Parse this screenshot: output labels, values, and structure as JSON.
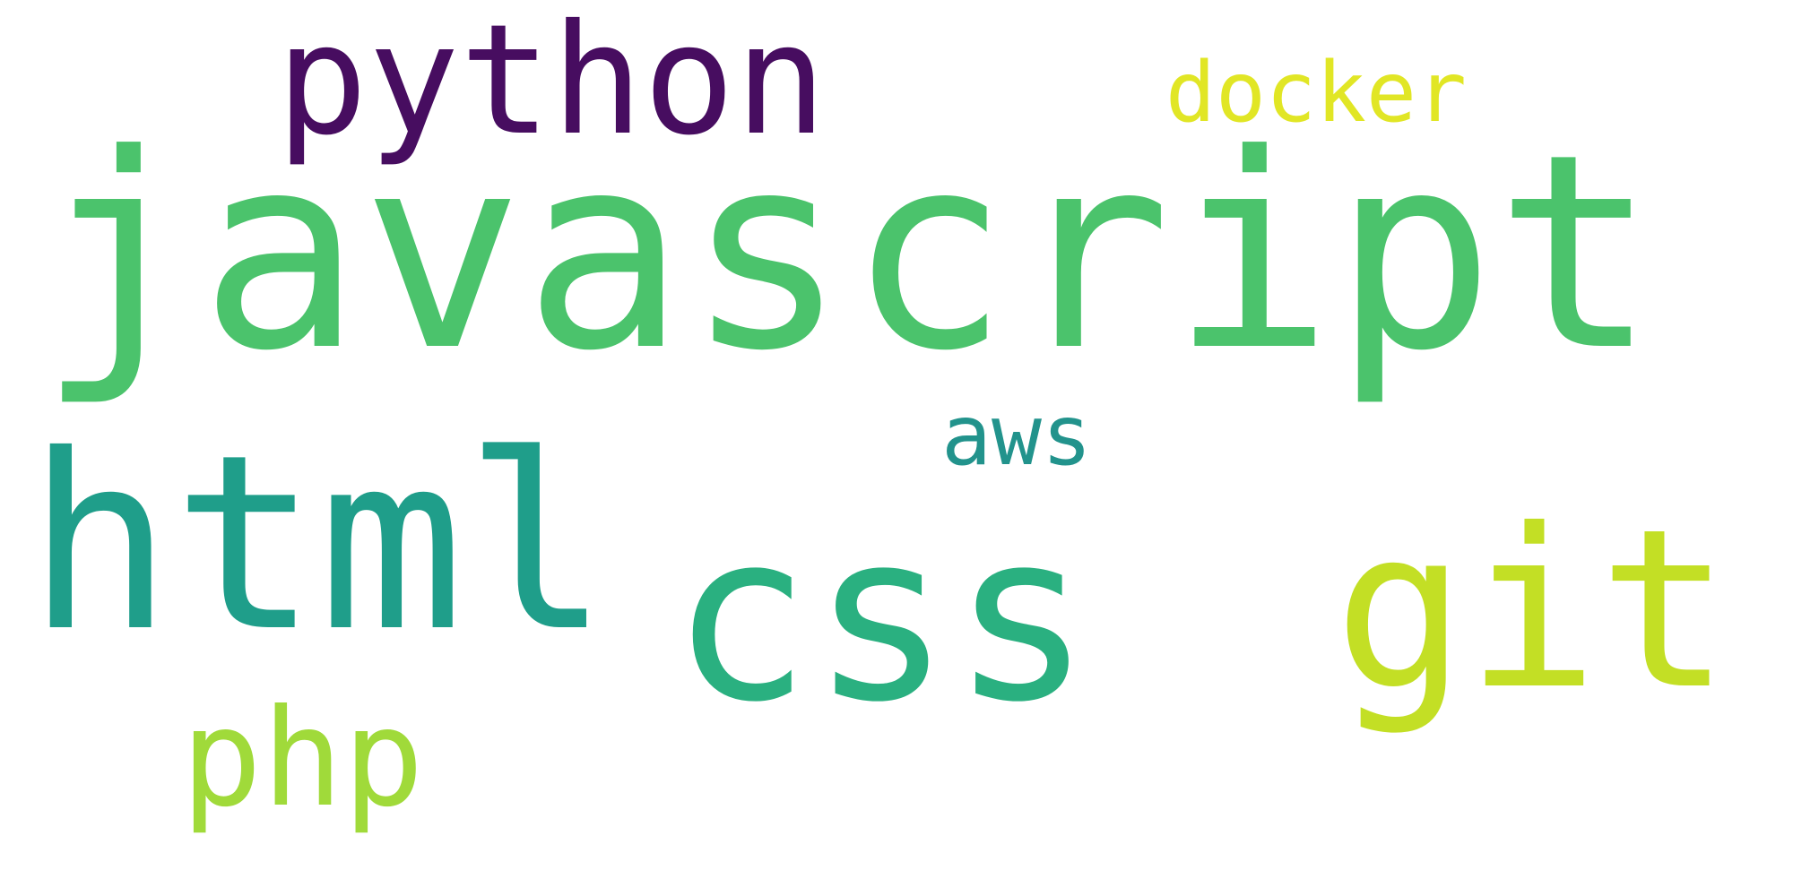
{
  "words": [
    {
      "text": "javascript",
      "color": "#4bc36c"
    },
    {
      "text": "html",
      "color": "#1f9e8a"
    },
    {
      "text": "css",
      "color": "#2ab080"
    },
    {
      "text": "git",
      "color": "#c3df25"
    },
    {
      "text": "python",
      "color": "#470d60"
    },
    {
      "text": "php",
      "color": "#a0da3a"
    },
    {
      "text": "docker",
      "color": "#e1e625"
    },
    {
      "text": "aws",
      "color": "#22938c"
    }
  ]
}
